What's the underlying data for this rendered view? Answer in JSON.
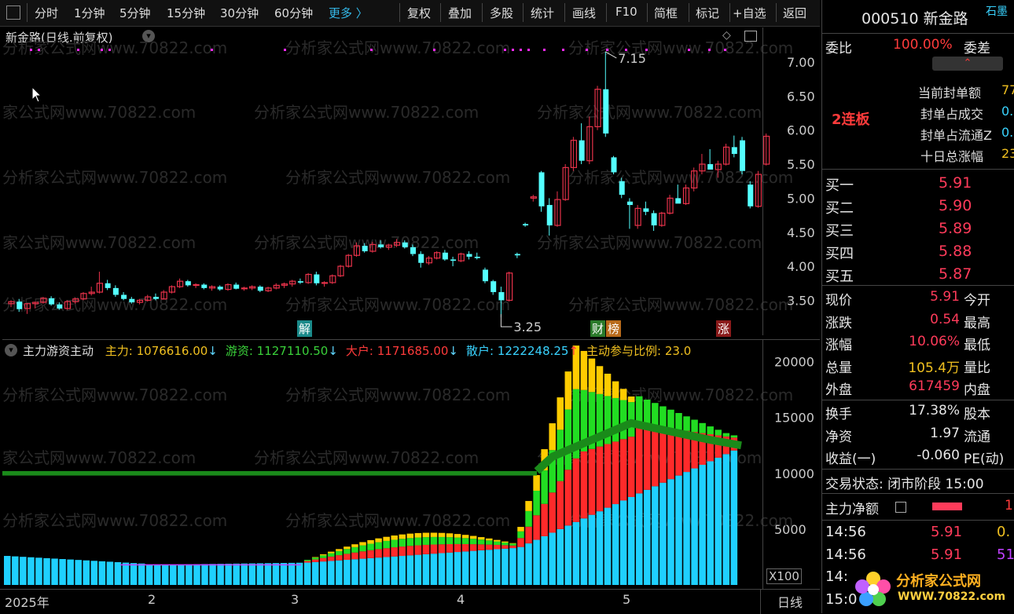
{
  "toolbar": {
    "items": [
      {
        "label": "分时"
      },
      {
        "label": "1分钟"
      },
      {
        "label": "5分钟"
      },
      {
        "label": "15分钟"
      },
      {
        "label": "30分钟"
      },
      {
        "label": "60分钟"
      },
      {
        "label": "更多 〉"
      },
      {
        "label": "复权"
      },
      {
        "label": "叠加"
      },
      {
        "label": "多股"
      },
      {
        "label": "统计"
      },
      {
        "label": "画线"
      },
      {
        "label": "F10"
      },
      {
        "label": "简框"
      },
      {
        "label": "标记"
      },
      {
        "label": "+自选"
      },
      {
        "label": "返回"
      }
    ]
  },
  "main_chart": {
    "title": "新金路(日线.前复权)",
    "price_ticks": [
      "7.00",
      "6.50",
      "6.00",
      "5.50",
      "5.00",
      "4.50",
      "4.00",
      "3.50"
    ],
    "high_marker": "7.15",
    "low_marker": "3.25",
    "event_labels": [
      {
        "text": "解",
        "color": "#1a8a8a"
      },
      {
        "text": "财",
        "color": "#2a7a2a"
      },
      {
        "text": "榜",
        "color": "#b86a1a"
      },
      {
        "text": "涨",
        "color": "#8a1a1a"
      }
    ],
    "watermark": "分析家公式网www.70822.com",
    "up_color": "#e8324a",
    "down_color": "#54ffff",
    "candles": [
      [
        3.45,
        3.5,
        3.4,
        3.48
      ],
      [
        3.48,
        3.52,
        3.33,
        3.37
      ],
      [
        3.38,
        3.46,
        3.3,
        3.45
      ],
      [
        3.45,
        3.48,
        3.38,
        3.47
      ],
      [
        3.47,
        3.55,
        3.45,
        3.53
      ],
      [
        3.53,
        3.56,
        3.42,
        3.44
      ],
      [
        3.44,
        3.47,
        3.36,
        3.38
      ],
      [
        3.38,
        3.5,
        3.36,
        3.48
      ],
      [
        3.48,
        3.54,
        3.45,
        3.52
      ],
      [
        3.52,
        3.62,
        3.5,
        3.6
      ],
      [
        3.6,
        3.7,
        3.57,
        3.62
      ],
      [
        3.62,
        3.92,
        3.6,
        3.75
      ],
      [
        3.75,
        3.8,
        3.65,
        3.68
      ],
      [
        3.68,
        3.72,
        3.55,
        3.58
      ],
      [
        3.58,
        3.62,
        3.5,
        3.52
      ],
      [
        3.52,
        3.55,
        3.45,
        3.47
      ],
      [
        3.47,
        3.52,
        3.44,
        3.5
      ],
      [
        3.5,
        3.58,
        3.48,
        3.55
      ],
      [
        3.55,
        3.6,
        3.5,
        3.52
      ],
      [
        3.52,
        3.65,
        3.51,
        3.62
      ],
      [
        3.62,
        3.72,
        3.6,
        3.7
      ],
      [
        3.7,
        3.82,
        3.68,
        3.78
      ],
      [
        3.78,
        3.8,
        3.7,
        3.72
      ],
      [
        3.72,
        3.75,
        3.68,
        3.73
      ],
      [
        3.73,
        3.75,
        3.66,
        3.68
      ],
      [
        3.68,
        3.72,
        3.64,
        3.7
      ],
      [
        3.7,
        3.72,
        3.64,
        3.66
      ],
      [
        3.66,
        3.75,
        3.64,
        3.73
      ],
      [
        3.73,
        3.76,
        3.66,
        3.67
      ],
      [
        3.67,
        3.7,
        3.64,
        3.68
      ],
      [
        3.68,
        3.72,
        3.65,
        3.7
      ],
      [
        3.7,
        3.72,
        3.62,
        3.64
      ],
      [
        3.64,
        3.7,
        3.62,
        3.68
      ],
      [
        3.68,
        3.75,
        3.66,
        3.72
      ],
      [
        3.72,
        3.76,
        3.68,
        3.74
      ],
      [
        3.74,
        3.8,
        3.7,
        3.78
      ],
      [
        3.78,
        3.82,
        3.74,
        3.76
      ],
      [
        3.76,
        3.9,
        3.74,
        3.88
      ],
      [
        3.88,
        3.92,
        3.72,
        3.75
      ],
      [
        3.75,
        3.78,
        3.7,
        3.76
      ],
      [
        3.76,
        3.88,
        3.74,
        3.86
      ],
      [
        3.86,
        4.02,
        3.84,
        4.0
      ],
      [
        4.0,
        4.18,
        3.98,
        4.16
      ],
      [
        4.16,
        4.35,
        4.14,
        4.3
      ],
      [
        4.3,
        4.34,
        4.2,
        4.22
      ],
      [
        4.22,
        4.36,
        4.2,
        4.32
      ],
      [
        4.32,
        4.38,
        4.26,
        4.28
      ],
      [
        4.28,
        4.33,
        4.24,
        4.31
      ],
      [
        4.31,
        4.4,
        4.28,
        4.35
      ],
      [
        4.35,
        4.38,
        4.26,
        4.28
      ],
      [
        4.28,
        4.32,
        4.15,
        4.18
      ],
      [
        4.18,
        4.22,
        3.98,
        4.05
      ],
      [
        4.05,
        4.15,
        4.02,
        4.12
      ],
      [
        4.12,
        4.22,
        4.1,
        4.2
      ],
      [
        4.2,
        4.24,
        4.08,
        4.1
      ],
      [
        4.1,
        4.14,
        4.0,
        4.08
      ],
      [
        4.08,
        4.2,
        4.06,
        4.18
      ],
      [
        4.18,
        4.22,
        4.1,
        4.14
      ],
      [
        4.14,
        4.2,
        4.1,
        4.12
      ],
      [
        3.95,
        3.98,
        3.75,
        3.78
      ],
      [
        3.78,
        3.8,
        3.58,
        3.62
      ],
      [
        3.62,
        3.7,
        3.25,
        3.5
      ],
      [
        3.5,
        3.92,
        3.48,
        3.9
      ],
      [
        4.18,
        4.2,
        4.12,
        4.16
      ],
      [
        4.62,
        4.64,
        4.58,
        4.6
      ],
      [
        5.0,
        5.05,
        4.95,
        5.02
      ],
      [
        5.38,
        5.4,
        4.8,
        4.88
      ],
      [
        4.9,
        5.0,
        4.45,
        4.6
      ],
      [
        4.6,
        5.1,
        4.58,
        4.98
      ],
      [
        4.98,
        5.5,
        4.96,
        5.45
      ],
      [
        5.45,
        5.9,
        5.4,
        5.85
      ],
      [
        5.85,
        6.1,
        5.5,
        5.55
      ],
      [
        5.55,
        6.2,
        5.5,
        6.05
      ],
      [
        6.05,
        6.65,
        6.0,
        6.6
      ],
      [
        6.6,
        7.15,
        5.9,
        5.95
      ],
      [
        5.6,
        5.62,
        5.35,
        5.38
      ],
      [
        5.25,
        5.3,
        5.0,
        5.05
      ],
      [
        4.95,
        5.0,
        4.55,
        4.9
      ],
      [
        4.6,
        4.9,
        4.55,
        4.85
      ],
      [
        4.85,
        4.95,
        4.75,
        4.8
      ],
      [
        4.78,
        4.82,
        4.52,
        4.6
      ],
      [
        4.6,
        4.8,
        4.58,
        4.78
      ],
      [
        4.78,
        5.05,
        4.76,
        5.0
      ],
      [
        5.0,
        5.2,
        4.95,
        4.92
      ],
      [
        4.92,
        5.2,
        4.9,
        5.15
      ],
      [
        5.15,
        5.45,
        5.1,
        5.4
      ],
      [
        5.4,
        5.65,
        5.35,
        5.5
      ],
      [
        5.5,
        5.72,
        5.45,
        5.42
      ],
      [
        5.42,
        5.55,
        5.3,
        5.5
      ],
      [
        5.5,
        5.8,
        5.48,
        5.75
      ],
      [
        5.75,
        5.92,
        5.6,
        5.65
      ],
      [
        5.85,
        5.9,
        5.35,
        5.4
      ],
      [
        5.2,
        5.25,
        4.85,
        4.88
      ],
      [
        4.88,
        5.4,
        4.86,
        5.35
      ],
      [
        5.5,
        5.95,
        5.48,
        5.91
      ]
    ]
  },
  "indicator": {
    "name": "主力游资主动",
    "labels": [
      {
        "text": "主力: 1076616.00",
        "color": "#f0c020",
        "arrow": "↓",
        "arrow_color": "#5fd7ff"
      },
      {
        "text": "游资: 1127110.50",
        "color": "#3ad13a",
        "arrow": "↓",
        "arrow_color": "#5fd7ff"
      },
      {
        "text": "大户: 1171685.00",
        "color": "#ff3b3b",
        "arrow": "↓",
        "arrow_color": "#5fd7ff"
      },
      {
        "text": "散户: 1222248.25",
        "color": "#39d3ff",
        "arrow": "↑",
        "arrow_color": "#ff3b3b"
      },
      {
        "text": "主动参与比例: 23.0",
        "color": "#f0c020",
        "arrow": "",
        "arrow_color": ""
      }
    ],
    "y_ticks": [
      "20000",
      "15000",
      "10000",
      "5000"
    ],
    "unit_label": "X100"
  },
  "x_axis": {
    "labels": [
      "2025年",
      "2",
      "3",
      "4",
      "5"
    ],
    "period": "日线"
  },
  "quote": {
    "code_name": "000510 新金路",
    "graphite_tag": "石墨",
    "weibi_label": "委比",
    "weibi_value": "100.00%",
    "weicha_label": "委差",
    "board_tag": "2连板",
    "seal_items": [
      {
        "label": "当前封单额",
        "value": "77"
      },
      {
        "label": "封单占成交",
        "value": "0."
      },
      {
        "label": "封单占流通Z",
        "value": "0."
      },
      {
        "label": "十日总涨幅",
        "value": "23"
      }
    ],
    "bids": [
      {
        "label": "买一",
        "price": "5.91"
      },
      {
        "label": "买二",
        "price": "5.90"
      },
      {
        "label": "买三",
        "price": "5.89"
      },
      {
        "label": "买四",
        "price": "5.88"
      },
      {
        "label": "买五",
        "price": "5.87"
      }
    ],
    "stats": [
      {
        "l1": "现价",
        "v1": "5.91",
        "c1": "red",
        "l2": "今开"
      },
      {
        "l1": "涨跌",
        "v1": "0.54",
        "c1": "red",
        "l2": "最高"
      },
      {
        "l1": "涨幅",
        "v1": "10.06%",
        "c1": "red",
        "l2": "最低"
      },
      {
        "l1": "总量",
        "v1": "105.4万",
        "c1": "yellow",
        "l2": "量比"
      },
      {
        "l1": "外盘",
        "v1": "617459",
        "c1": "red",
        "l2": "内盘"
      }
    ],
    "stats2": [
      {
        "l1": "换手",
        "v1": "17.38%",
        "l2": "股本"
      },
      {
        "l1": "净资",
        "v1": "1.97",
        "l2": "流通"
      },
      {
        "l1": "收益(一)",
        "v1": "-0.060",
        "l2": "PE(动)"
      }
    ],
    "trade_status": "交易状态: 闭市阶段 15:00",
    "net_label": "主力净额",
    "net_value": "1",
    "ticks": [
      {
        "time": "14:56",
        "price": "5.91",
        "vol": "0.",
        "vol_color": "#f0c020"
      },
      {
        "time": "14:56",
        "price": "5.91",
        "vol": "51.",
        "vol_color": "#c040ff"
      },
      {
        "time": "14:",
        "price": "",
        "vol": "",
        "vol_color": ""
      },
      {
        "time": "15:0",
        "price": "",
        "vol": "",
        "vol_color": ""
      }
    ]
  },
  "logo": {
    "title": "分析家公式网",
    "url": "WWW.70822.com"
  }
}
